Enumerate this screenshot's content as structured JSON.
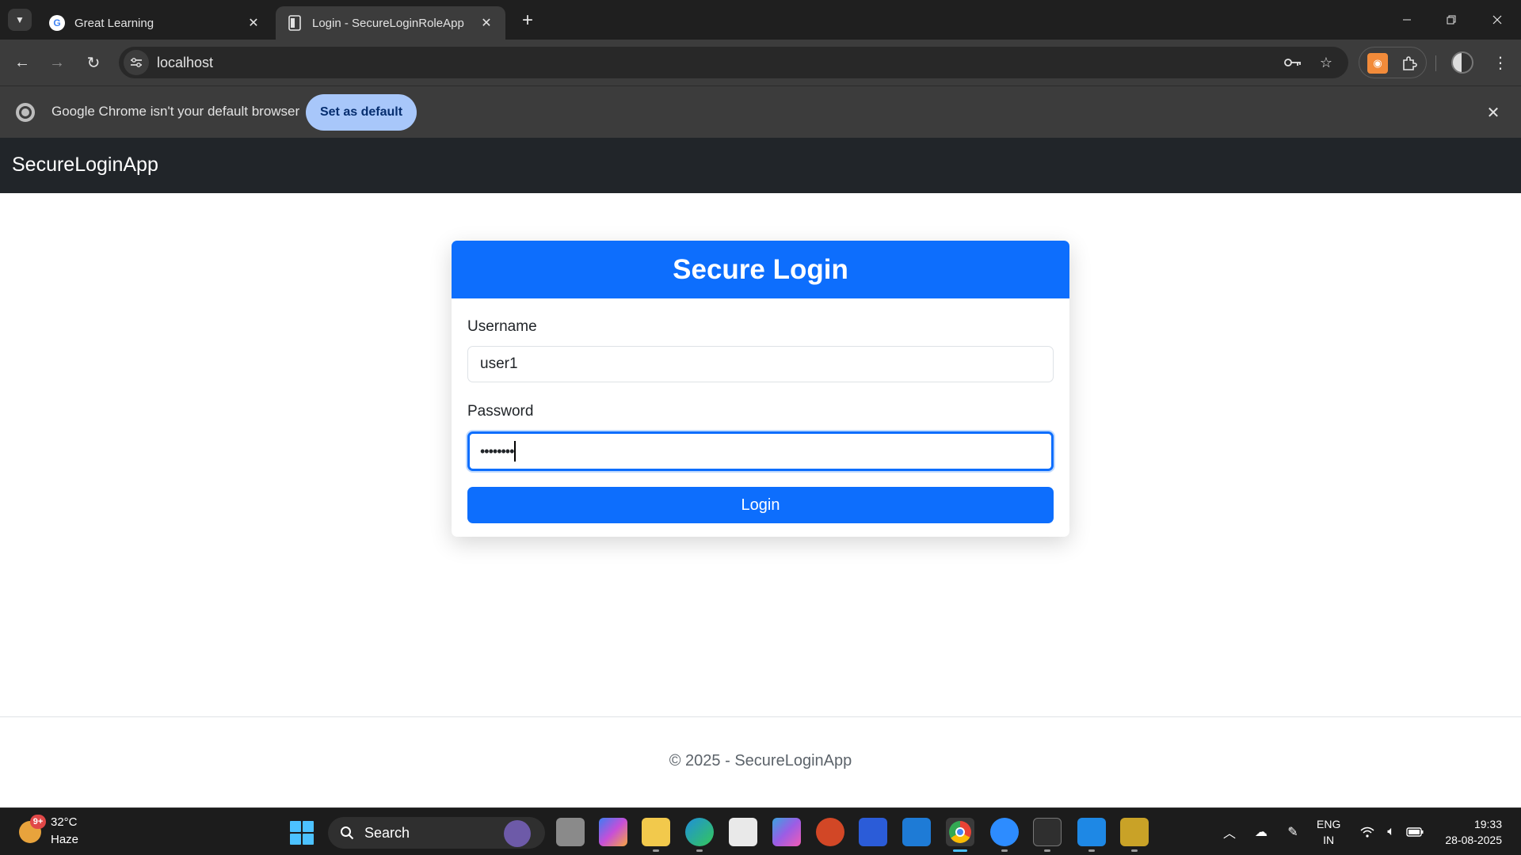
{
  "browser": {
    "tabs": [
      {
        "title": "Great Learning",
        "favicon": "google-g-icon",
        "active": false
      },
      {
        "title": "Login - SecureLoginRoleApp",
        "favicon": "page-icon",
        "active": true
      }
    ],
    "url": "localhost",
    "infobar": {
      "message": "Google Chrome isn't your default browser",
      "button_label": "Set as default"
    }
  },
  "app": {
    "brand": "SecureLoginApp",
    "login_card": {
      "title": "Secure Login",
      "username_label": "Username",
      "username_value": "user1",
      "password_label": "Password",
      "password_value": "••••••••",
      "submit_label": "Login"
    },
    "footer": "© 2025 - SecureLoginApp"
  },
  "colors": {
    "primary": "#0d6efd",
    "navbar": "#212529",
    "chrome_dark": "#1f1f1f",
    "infobar_button": "#a8c7fa"
  },
  "taskbar": {
    "weather": {
      "temp": "32°C",
      "condition": "Haze",
      "badge": "9+"
    },
    "search_placeholder": "Search",
    "apps": [
      "task-view",
      "copilot",
      "file-explorer",
      "edge",
      "microsoft-store",
      "m365",
      "powerpoint",
      "dev-home",
      "windows-app",
      "chrome",
      "zoom",
      "terminal",
      "vscode",
      "tool-app"
    ],
    "language": {
      "line1": "ENG",
      "line2": "IN"
    },
    "clock": {
      "time": "19:33",
      "date": "28-08-2025"
    }
  }
}
